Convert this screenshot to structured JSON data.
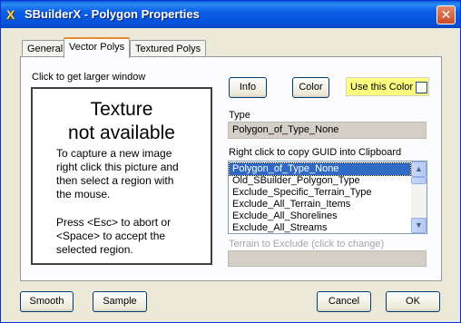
{
  "window": {
    "title": "SBuilderX - Polygon Properties",
    "app_icon_glyph": "X",
    "close_glyph": "✕"
  },
  "tabs": [
    {
      "label": "General",
      "active": false
    },
    {
      "label": "Vector Polys",
      "active": true
    },
    {
      "label": "Textured Polys",
      "active": false
    }
  ],
  "texture": {
    "hint": "Click to get larger window",
    "title_line1": "Texture",
    "title_line2": "not available",
    "capture_line1": "To capture a new image",
    "capture_line2": "right click this picture and",
    "capture_line3": "then select a region with",
    "capture_line4": "the mouse.",
    "press_line1": "Press <Esc> to abort or",
    "press_line2": "<Space> to accept the",
    "press_line3": "selected region."
  },
  "buttons": {
    "info": "Info",
    "color": "Color",
    "smooth": "Smooth",
    "sample": "Sample",
    "cancel": "Cancel",
    "ok": "OK"
  },
  "use_color": {
    "label": "Use this Color",
    "checked": false,
    "bg": "#ffff80"
  },
  "type": {
    "label": "Type",
    "value": "Polygon_of_Type_None"
  },
  "guid_list": {
    "label": "Right click to copy GUID into Clipboard",
    "items": [
      "Polygon_of_Type_None",
      "Old_SBuilder_Polygon_Type",
      "Exclude_Specific_Terrain_Type",
      "Exclude_All_Terrain_Items",
      "Exclude_All_Shorelines",
      "Exclude_All_Streams"
    ],
    "selected_index": 0
  },
  "terrain_exclude": {
    "label": "Terrain to Exclude (click to change)",
    "value": ""
  },
  "colors": {
    "selection": "#316ac5",
    "title_bar": "#0553dd",
    "dialog_bg": "#ece9d8"
  }
}
